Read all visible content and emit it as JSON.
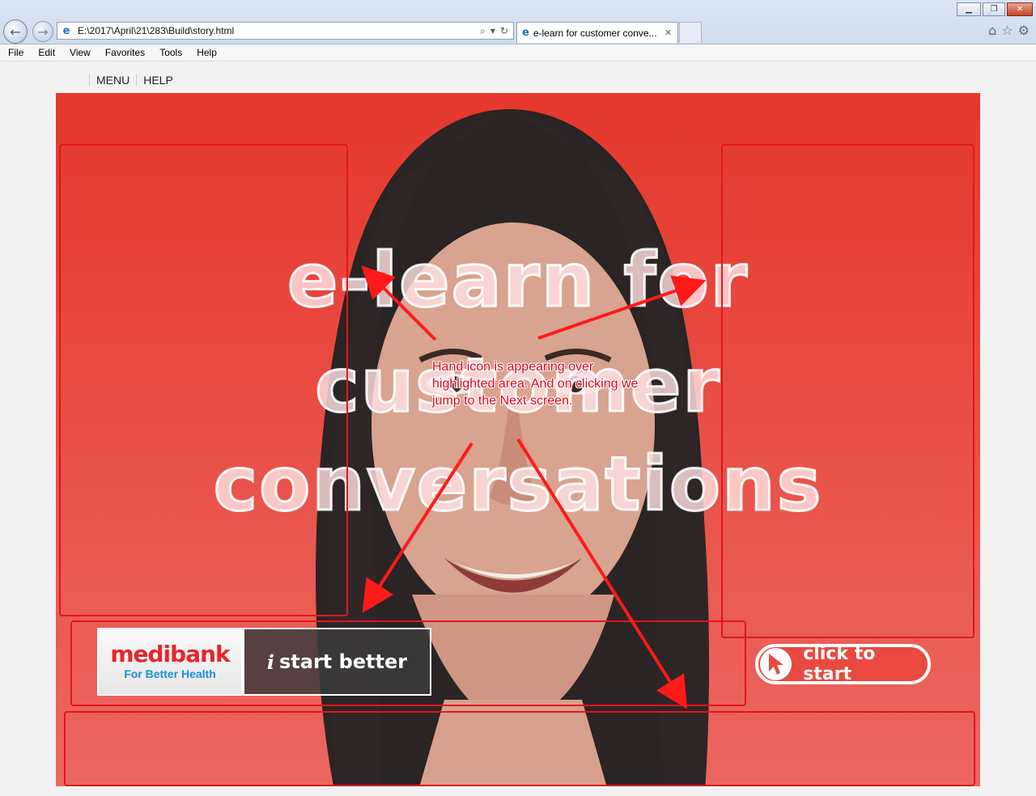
{
  "browser": {
    "url": "E:\\2017\\April\\21\\283\\Build\\story.html",
    "tab_title": "e-learn for customer conve...",
    "menu": [
      "File",
      "Edit",
      "View",
      "Favorites",
      "Tools",
      "Help"
    ]
  },
  "player_menu": [
    "MENU",
    "HELP"
  ],
  "slide": {
    "title_lines": [
      "e-learn for",
      "customer",
      "conversations"
    ],
    "logo_brand": "medibank",
    "logo_tagline": "For Better Health",
    "slogan_i": "i",
    "slogan_rest": "start better",
    "start_label": "click to start"
  },
  "annotation": {
    "note": "Hand icon is appearing over highlighted area. And on clicking we jump to the Next screen.",
    "color": "#e2001a"
  }
}
